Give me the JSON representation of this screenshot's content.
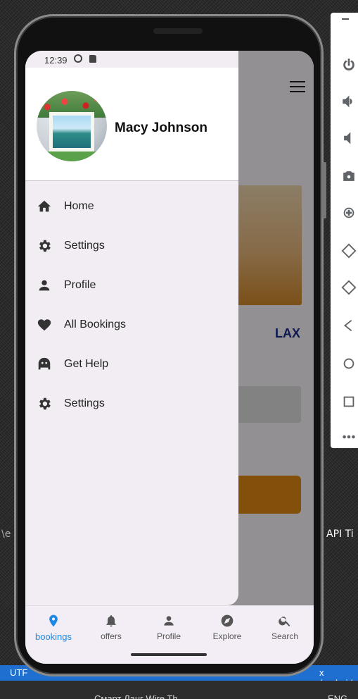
{
  "phone": {
    "status_bar": {
      "time": "12:39"
    },
    "drawer": {
      "user_name": "Macy Johnson",
      "items": [
        {
          "label": "Home",
          "icon": "home-icon"
        },
        {
          "label": "Settings",
          "icon": "gear-icon"
        },
        {
          "label": "Profile",
          "icon": "person-icon"
        },
        {
          "label": "All Bookings",
          "icon": "heart-icon"
        },
        {
          "label": "Get Help",
          "icon": "help-bot-icon"
        },
        {
          "label": "Settings",
          "icon": "gear-icon"
        }
      ]
    },
    "app": {
      "airport_code": "LAX"
    },
    "bottom_nav": [
      {
        "label": "bookings",
        "icon": "location-pin-icon",
        "active": true
      },
      {
        "label": "offers",
        "icon": "bell-icon",
        "active": false
      },
      {
        "label": "Profile",
        "icon": "person-icon",
        "active": false
      },
      {
        "label": "Explore",
        "icon": "compass-icon",
        "active": false
      },
      {
        "label": "Search",
        "icon": "search-icon",
        "active": false
      }
    ]
  },
  "desktop": {
    "side_text_left": "\\e",
    "side_text_right": "API Ti",
    "ide_status_left": "UTF",
    "ide_status_right": "x (android",
    "taskbar_item": "Смарт Ланг Wire Th",
    "taskbar_lang": "ENG"
  },
  "colors": {
    "accent": "#1e88e5",
    "lax_text": "#1a2b8c",
    "cta": "#e08a12",
    "drawer_bg": "#f1edf2"
  }
}
